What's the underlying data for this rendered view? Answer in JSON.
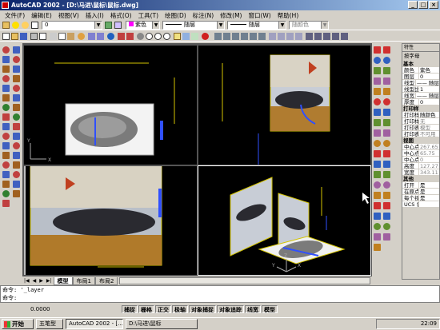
{
  "window": {
    "title": "AutoCAD 2002 - [D:\\马进\\鼠标\\鼠标.dwg]"
  },
  "menu": [
    "文件(F)",
    "编辑(E)",
    "视图(V)",
    "插入(I)",
    "格式(O)",
    "工具(T)",
    "绘图(D)",
    "标注(N)",
    "修改(M)",
    "窗口(W)",
    "帮助(H)"
  ],
  "layer_toolbar": {
    "layer_value": "0",
    "color_value": "紫色",
    "linetype_value": "随层",
    "lineweight_value": "随层",
    "plotstyle_value": "随颜色"
  },
  "viewports": {
    "top_left": {
      "axis_y": "Y",
      "axis_x": "X"
    },
    "bottom_right": {
      "axis_z": "Z",
      "axis_y": "Y",
      "axis_x": "X"
    }
  },
  "layout_tabs": {
    "model": "模型",
    "layout1": "布局1",
    "layout2": "布局2"
  },
  "properties": {
    "title": "特性",
    "combo": "按字母",
    "sections": [
      {
        "name": "基本",
        "rows": [
          {
            "k": "颜色",
            "v": "紫色"
          },
          {
            "k": "图层",
            "v": "0"
          },
          {
            "k": "线型",
            "v": "—— 随层"
          },
          {
            "k": "线型比",
            "v": "1"
          },
          {
            "k": "线宽",
            "v": "—— 随层"
          },
          {
            "k": "厚度",
            "v": "0"
          }
        ]
      },
      {
        "name": "打印样",
        "rows": [
          {
            "k": "打印样",
            "v": "随颜色"
          },
          {
            "k": "打印样",
            "v": "无"
          },
          {
            "k": "打印表",
            "v": "模型"
          },
          {
            "k": "打印表",
            "v": "不可用"
          }
        ]
      },
      {
        "name": "视图",
        "rows": [
          {
            "k": "中心点",
            "v": "267.65"
          },
          {
            "k": "中心点",
            "v": "65.75"
          },
          {
            "k": "中心点",
            "v": "0"
          },
          {
            "k": "高度",
            "v": "127.27"
          },
          {
            "k": "宽度",
            "v": "343.11"
          }
        ]
      },
      {
        "name": "其他",
        "rows": [
          {
            "k": "打开",
            "v": "是"
          },
          {
            "k": "在原点",
            "v": "是"
          },
          {
            "k": "每个视",
            "v": "是"
          },
          {
            "k": "UCS 名",
            "v": ""
          }
        ]
      }
    ]
  },
  "command": {
    "line1": "命令: '_layer",
    "line2": "命令:"
  },
  "status": {
    "coords": "0.0000",
    "buttons": [
      "捕捉",
      "栅格",
      "正交",
      "极轴",
      "对象捕捉",
      "对象追踪",
      "线宽",
      "模型"
    ]
  },
  "taskbar": {
    "start": "开始",
    "ime": "五笔型",
    "tasks": [
      "AutoCAD 2002 - [...",
      "D:\\马进\\鼠标"
    ],
    "clock": "22:09"
  },
  "colors": {
    "title_start": "#0a246a",
    "title_end": "#a6caf0",
    "viewport_bg": "#000000",
    "mouse_axis": "#3050ff",
    "guide_line": "#d4c400",
    "purple": "#ff00ff"
  }
}
